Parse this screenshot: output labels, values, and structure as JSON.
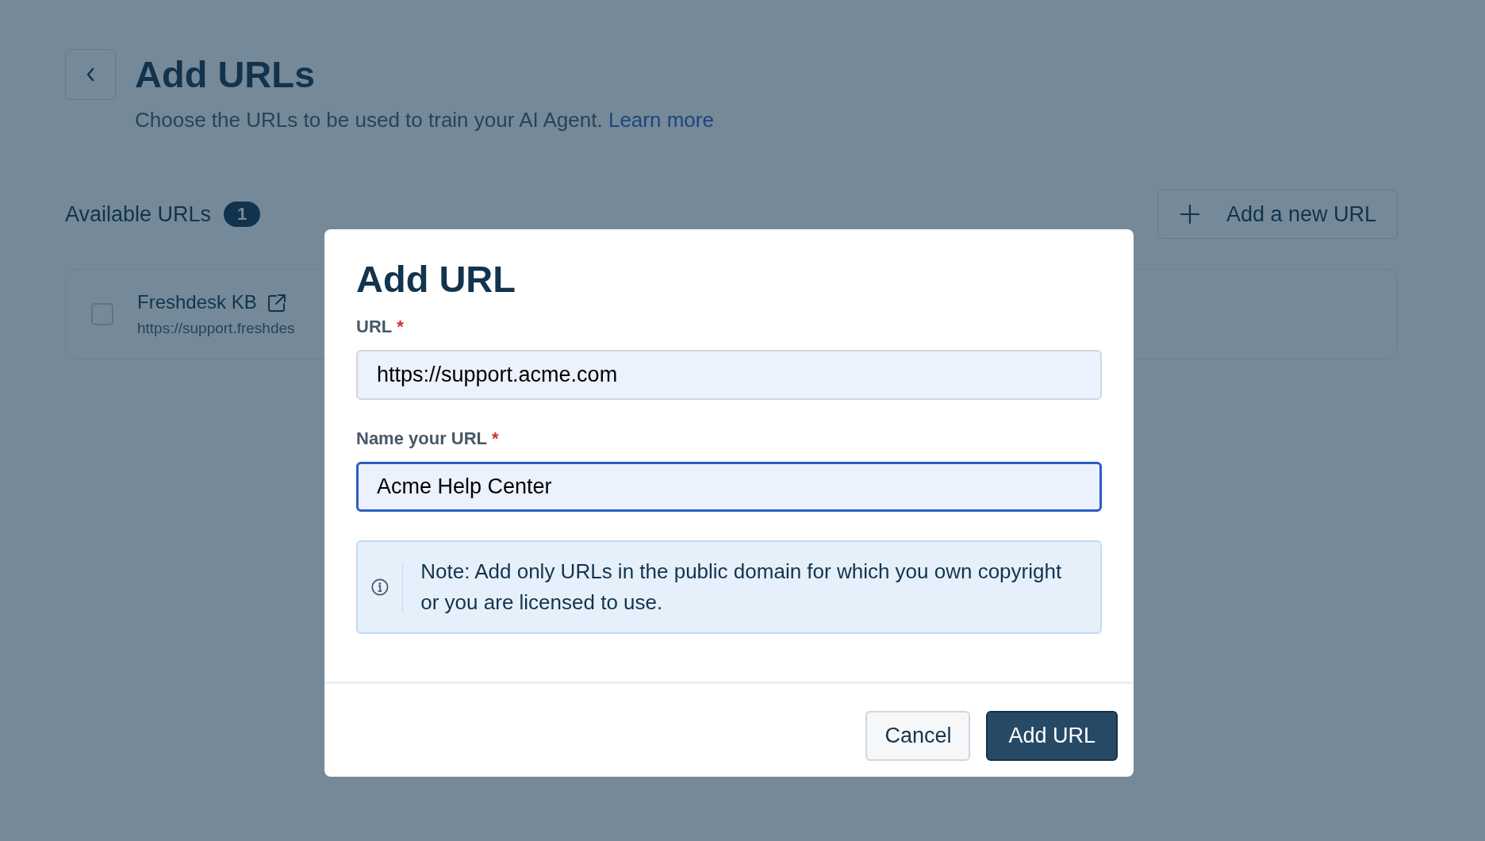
{
  "header": {
    "title": "Add URLs",
    "subtitle": "Choose the URLs to be used to train your AI Agent.",
    "link": "Learn more"
  },
  "section": {
    "title": "Available URLs",
    "count": "1",
    "add_button": "Add a new URL"
  },
  "urls": [
    {
      "name": "Freshdesk KB",
      "url": "https://support.freshdes",
      "checked": false
    }
  ],
  "dialog": {
    "title": "Add URL",
    "fields": [
      {
        "label": "URL",
        "required_mark": "*",
        "value": "https://support.acme.com",
        "focused": false
      },
      {
        "label": "Name your URL",
        "required_mark": "*",
        "value": "Acme Help Center",
        "focused": true
      }
    ],
    "note": "Note: Add only URLs in the public domain for which you own copyright or you are licensed to use.",
    "buttons": [
      {
        "label": "Cancel",
        "kind": "secondary"
      },
      {
        "label": "Add URL",
        "kind": "primary"
      }
    ]
  }
}
